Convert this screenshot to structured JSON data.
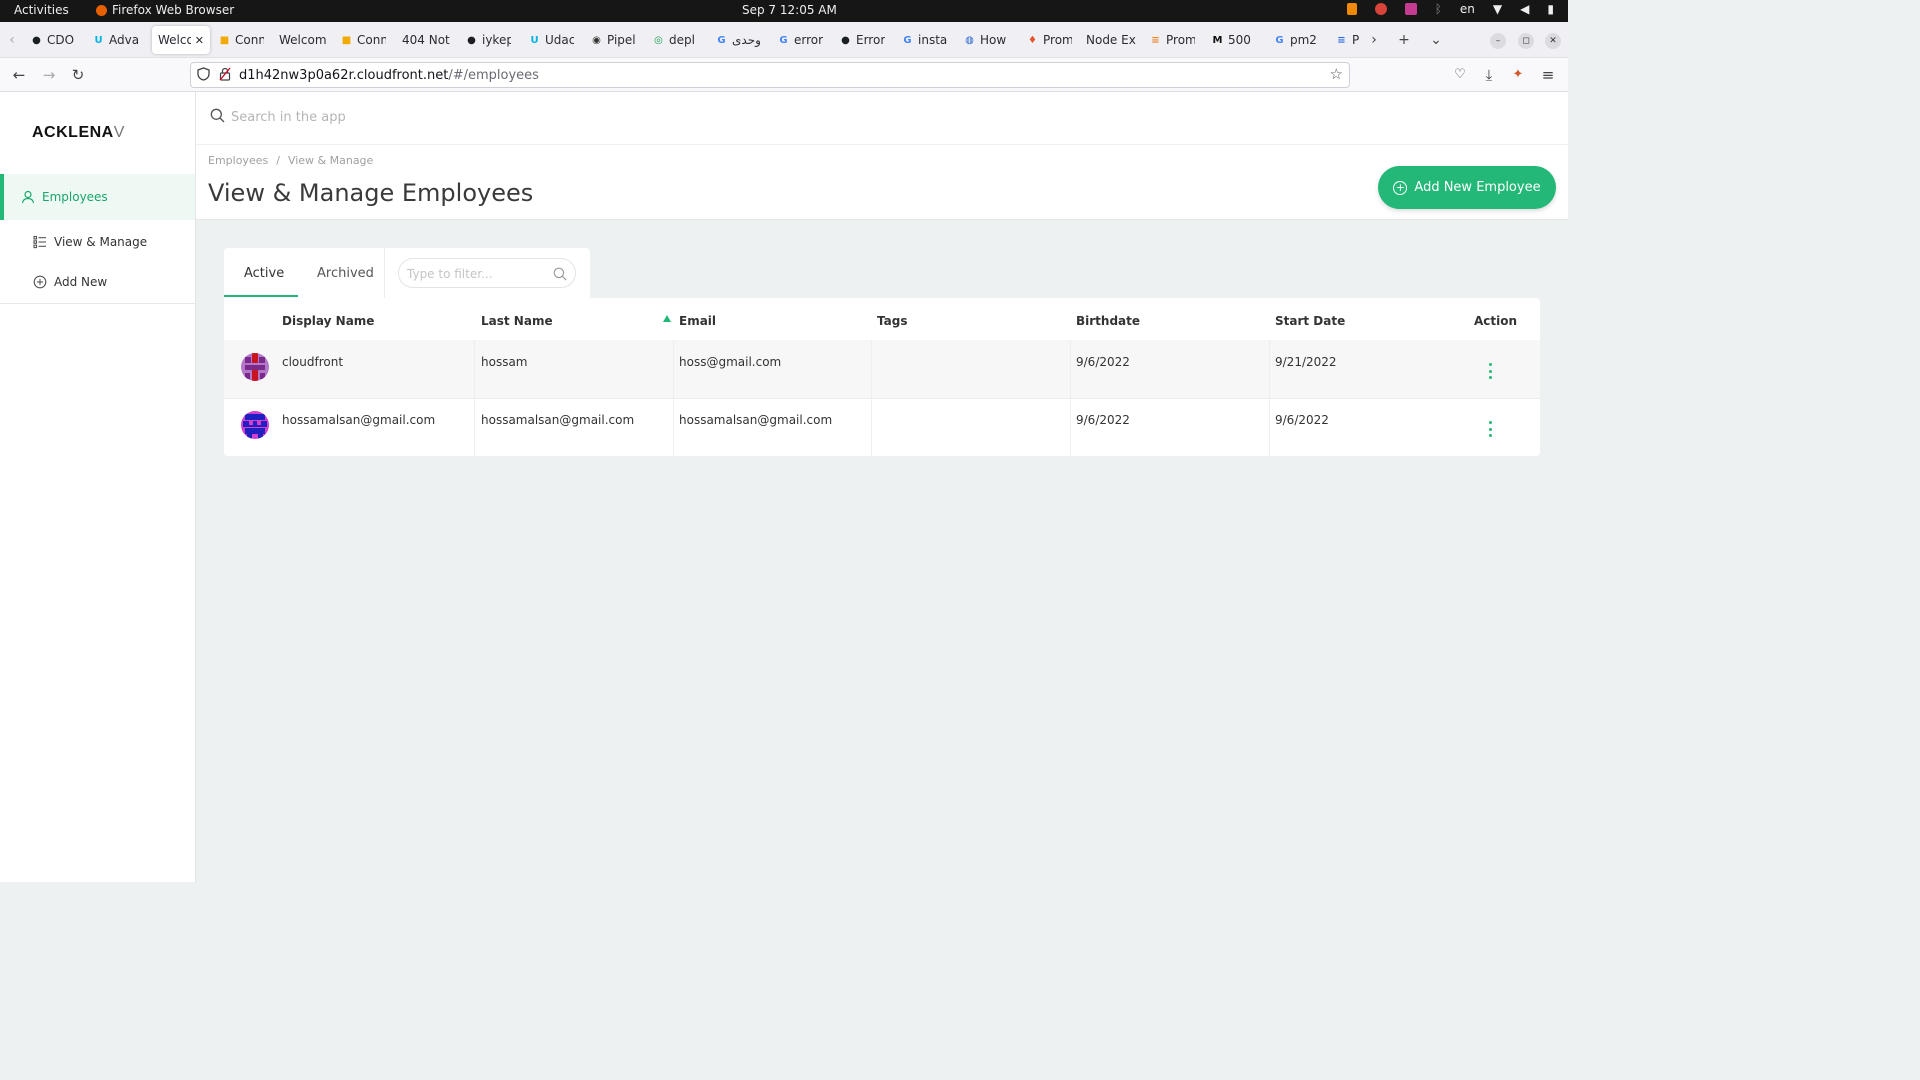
{
  "system_bar": {
    "activities": "Activities",
    "app_name": "Firefox Web Browser",
    "clock": "Sep 7  12:05 AM",
    "lang": "en"
  },
  "browser": {
    "tabs": [
      {
        "label": "CDO",
        "icon": "github-icon"
      },
      {
        "label": "Adva",
        "icon": "udacity-icon"
      },
      {
        "label": "Welco",
        "icon": "none",
        "active": true
      },
      {
        "label": "Conn",
        "icon": "box-icon"
      },
      {
        "label": "Welcom",
        "icon": "none"
      },
      {
        "label": "Conn",
        "icon": "box-icon"
      },
      {
        "label": "404 Not",
        "icon": "none"
      },
      {
        "label": "iykep",
        "icon": "github-icon"
      },
      {
        "label": "Udac",
        "icon": "udacity-icon"
      },
      {
        "label": "Pipel",
        "icon": "circleci-icon"
      },
      {
        "label": "depl",
        "icon": "circle-icon"
      },
      {
        "label": "وحدى",
        "icon": "google-icon"
      },
      {
        "label": "error",
        "icon": "google-icon"
      },
      {
        "label": "Error",
        "icon": "github-icon"
      },
      {
        "label": "insta",
        "icon": "google-icon"
      },
      {
        "label": "How",
        "icon": "globe-icon"
      },
      {
        "label": "Prom",
        "icon": "flame-icon"
      },
      {
        "label": "Node Ex",
        "icon": "none"
      },
      {
        "label": "Prom",
        "icon": "stack-icon"
      },
      {
        "label": "500",
        "icon": "m-icon"
      },
      {
        "label": "pm2",
        "icon": "google-icon"
      },
      {
        "label": "P",
        "icon": "lines-icon"
      }
    ],
    "url_host": "d1h42nw3p0a62r.cloudfront.net",
    "url_path": "/#/employees"
  },
  "app": {
    "logo_main": "ACKLENA",
    "logo_tail": "V",
    "search_placeholder": "Search in the app",
    "sidebar": {
      "items": [
        {
          "label": "Employees"
        },
        {
          "label": "View & Manage"
        },
        {
          "label": "Add New"
        }
      ]
    },
    "breadcrumb": [
      "Employees",
      "View & Manage"
    ],
    "breadcrumb_sep": "/",
    "page_title": "View & Manage Employees",
    "add_button": "Add New Employee",
    "tabs": [
      "Active",
      "Archived"
    ],
    "filter_placeholder": "Type to filter...",
    "table": {
      "columns": [
        "Display Name",
        "Last Name",
        "Email",
        "Tags",
        "Birthdate",
        "Start Date",
        "Action"
      ],
      "rows": [
        {
          "display_name": "cloudfront",
          "last_name": "hossam",
          "email": "hoss@gmail.com",
          "tags": "",
          "birthdate": "9/6/2022",
          "start_date": "9/21/2022"
        },
        {
          "display_name": "hossamalsan@gmail.com",
          "last_name": "hossamalsan@gmail.com",
          "email": "hossamalsan@gmail.com",
          "tags": "",
          "birthdate": "9/6/2022",
          "start_date": "9/6/2022"
        }
      ]
    },
    "colors": {
      "accent": "#23b877",
      "background": "#edf1f2"
    }
  }
}
